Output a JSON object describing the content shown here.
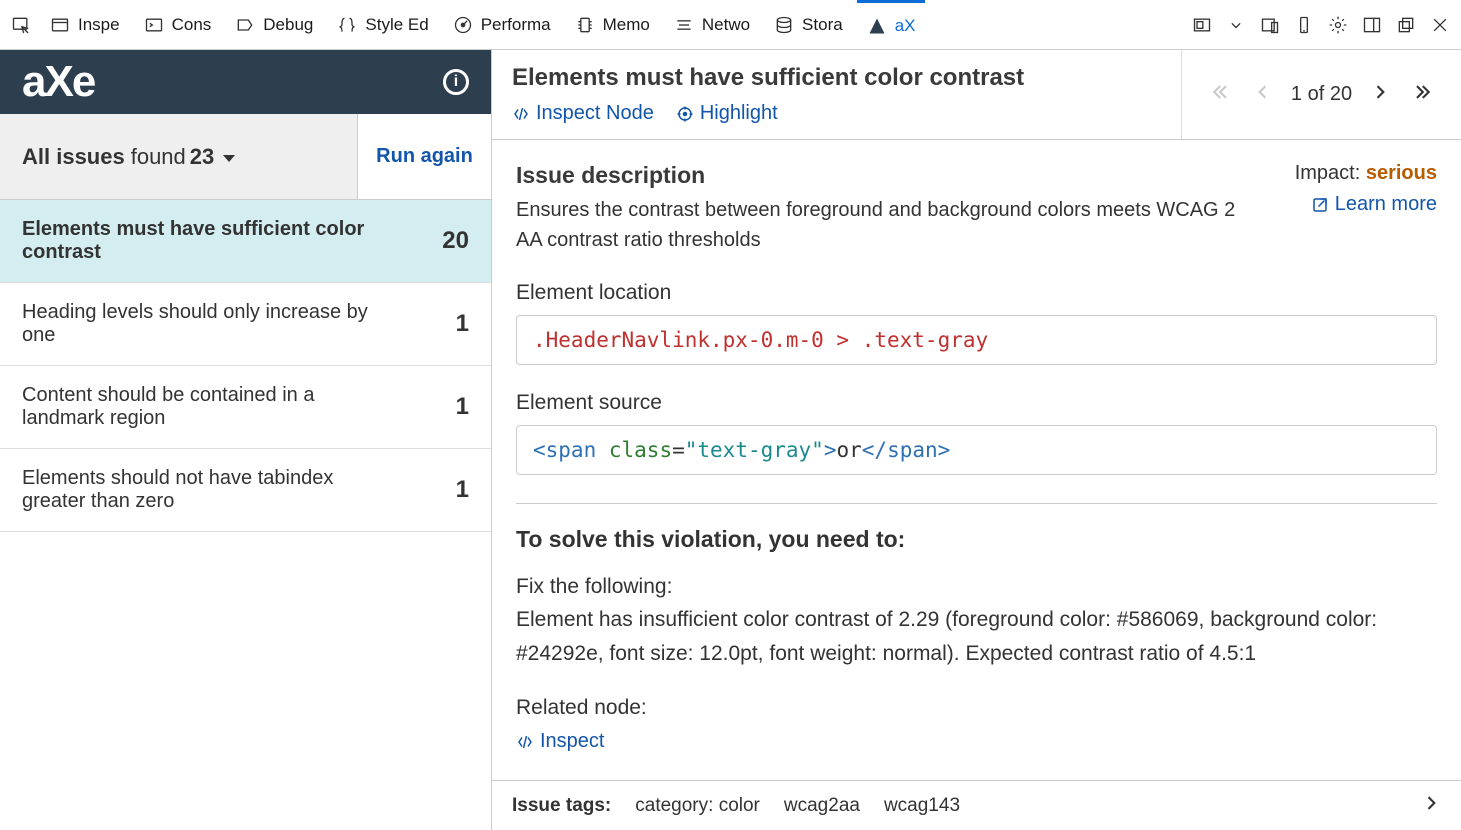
{
  "devtools": {
    "tabs": [
      "Inspe",
      "Cons",
      "Debug",
      "Style Ed",
      "Performa",
      "Memo",
      "Netwo",
      "Stora",
      "aX"
    ],
    "active_tab_index": 8
  },
  "sidebar": {
    "logo": "axe",
    "all_issues_label": "All issues",
    "all_issues_found": "found",
    "all_issues_count": "23",
    "run_again": "Run again",
    "items": [
      {
        "label": "Elements must have sufficient color contrast",
        "count": "20",
        "selected": true
      },
      {
        "label": "Heading levels should only increase by one",
        "count": "1",
        "selected": false
      },
      {
        "label": "Content should be contained in a landmark region",
        "count": "1",
        "selected": false
      },
      {
        "label": "Elements should not have tabindex greater than zero",
        "count": "1",
        "selected": false
      }
    ]
  },
  "detail": {
    "title": "Elements must have sufficient color contrast",
    "inspect_node": "Inspect Node",
    "highlight": "Highlight",
    "pager": {
      "current": "1",
      "total": "20",
      "sep": "of"
    },
    "issue_description_h": "Issue description",
    "issue_description": "Ensures the contrast between foreground and background colors meets WCAG 2 AA contrast ratio thresholds",
    "impact_label": "Impact:",
    "impact_value": "serious",
    "learn_more": "Learn more",
    "element_location_h": "Element location",
    "element_location": ".HeaderNavlink.px-0.m-0 > .text-gray",
    "element_source_h": "Element source",
    "source": {
      "open_tag": "<span",
      "attr_name": "class",
      "eq": "=",
      "attr_val": "\"text-gray\"",
      "gt": ">",
      "text": "or",
      "close_tag": "</span>"
    },
    "solve_h": "To solve this violation, you need to:",
    "fix_h": "Fix the following:",
    "fix_text": "Element has insufficient color contrast of 2.29 (foreground color: #586069, background color: #24292e, font size: 12.0pt, font weight: normal). Expected contrast ratio of 4.5:1",
    "related_h": "Related node:",
    "related_inspect": "Inspect",
    "tags_label": "Issue tags:",
    "tags": [
      "category: color",
      "wcag2aa",
      "wcag143"
    ]
  }
}
